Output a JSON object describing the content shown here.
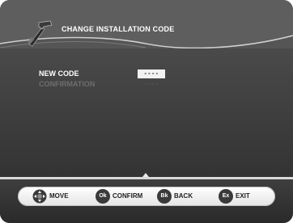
{
  "window": {
    "title": "CHANGE INSTALLATION CODE"
  },
  "form": {
    "new_code": {
      "label": "NEW CODE",
      "value": "----"
    },
    "confirmation": {
      "label": "CONFIRMATION",
      "value": "----"
    }
  },
  "footer": {
    "buttons": [
      {
        "key": "",
        "label": "MOVE",
        "icon": "dpad-icon"
      },
      {
        "key": "Ok",
        "label": "CONFIRM",
        "icon": "ok-key-icon"
      },
      {
        "key": "Bk",
        "label": "BACK",
        "icon": "back-key-icon"
      },
      {
        "key": "Ex",
        "label": "EXIT",
        "icon": "exit-key-icon"
      }
    ]
  },
  "colors": {
    "screen_bg": "#555555",
    "title_text": "#ffffff",
    "active_label": "#ffffff",
    "inactive_label": "#6e6e6e"
  }
}
